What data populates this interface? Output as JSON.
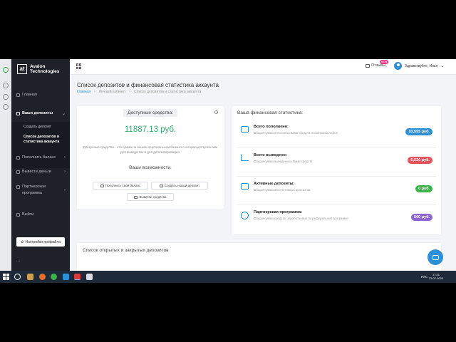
{
  "colors": {
    "accent": "#2d8fd5",
    "amount_green": "#3aa76d",
    "sidebar_bg": "#1f2129",
    "pill_blue": "#2d8fd5",
    "pill_red": "#e8505b",
    "pill_green": "#3bb54a",
    "pill_purple": "#8e63d3"
  },
  "logo": {
    "mark": "at",
    "line1": "Avalon",
    "line2": "Technologies"
  },
  "sidebar": {
    "items": [
      {
        "label": "Главная",
        "icon": "home-icon"
      },
      {
        "label": "Ваши депозиты",
        "icon": "deposit-icon"
      },
      {
        "label": "Пополнить баланс",
        "icon": "wallet-icon"
      },
      {
        "label": "Вывести деньги",
        "icon": "withdraw-icon"
      },
      {
        "label": "Партнерская программа",
        "icon": "partner-icon"
      },
      {
        "label": "Выйти",
        "icon": "logout-icon"
      }
    ],
    "sub_items": [
      {
        "label": "Создать депозит"
      },
      {
        "label": "Список депозитов и статистика аккаунта"
      }
    ],
    "settings_button": "Настройки профайла",
    "dots": "..."
  },
  "topbar": {
    "reviews_label": "Отзывы",
    "new_badge": "NEW",
    "greeting": "Здравствуйте, Илья"
  },
  "page": {
    "title": "Список депозитов и финансовая статистика аккаунта",
    "breadcrumb": [
      "Главная",
      "Личный кабинет",
      "Список депозитов и статистика аккаунта"
    ]
  },
  "balance_card": {
    "title": "Доступные средства:",
    "amount": "11887.13 руб.",
    "description": "Доступные средства - это сумма на вашем персональном балансе, которая доступна вам для вывода так и для депозитирования.",
    "capabilities_title": "Ваши возможности:",
    "buttons": [
      "Пополнить свой баланс",
      "Создать новый депозит",
      "Вывести средства"
    ]
  },
  "stats_card": {
    "title": "Ваша финансовая статистика:",
    "rows": [
      {
        "label": "Всего пополнено:",
        "desc": "Общая сумма внесенных Вами средств в компанию Avalon",
        "value": "10,555 руб.",
        "color": "#2d8fd5",
        "icon": "wallet-icon"
      },
      {
        "label": "Всего выведено:",
        "desc": "Общая сумма выведенных Вами средств",
        "value": "5,520 руб.",
        "color": "#e8505b",
        "icon": "trend-icon"
      },
      {
        "label": "Активные депозиты:",
        "desc": "Общая сумма всех активных депозитов",
        "value": "0 руб.",
        "color": "#3bb54a",
        "icon": "briefcase-icon"
      },
      {
        "label": "Партнерская программа:",
        "desc": "Общая сумма средств, заработанных по реферальной программе",
        "value": "500 руб.",
        "color": "#8e63d3",
        "icon": "user-icon"
      }
    ]
  },
  "deposits_card": {
    "title": "Список открытых и закрытых депозитов"
  },
  "taskbar": {
    "lang": "РУС",
    "time": "17:21",
    "date": "23.07.2020"
  }
}
